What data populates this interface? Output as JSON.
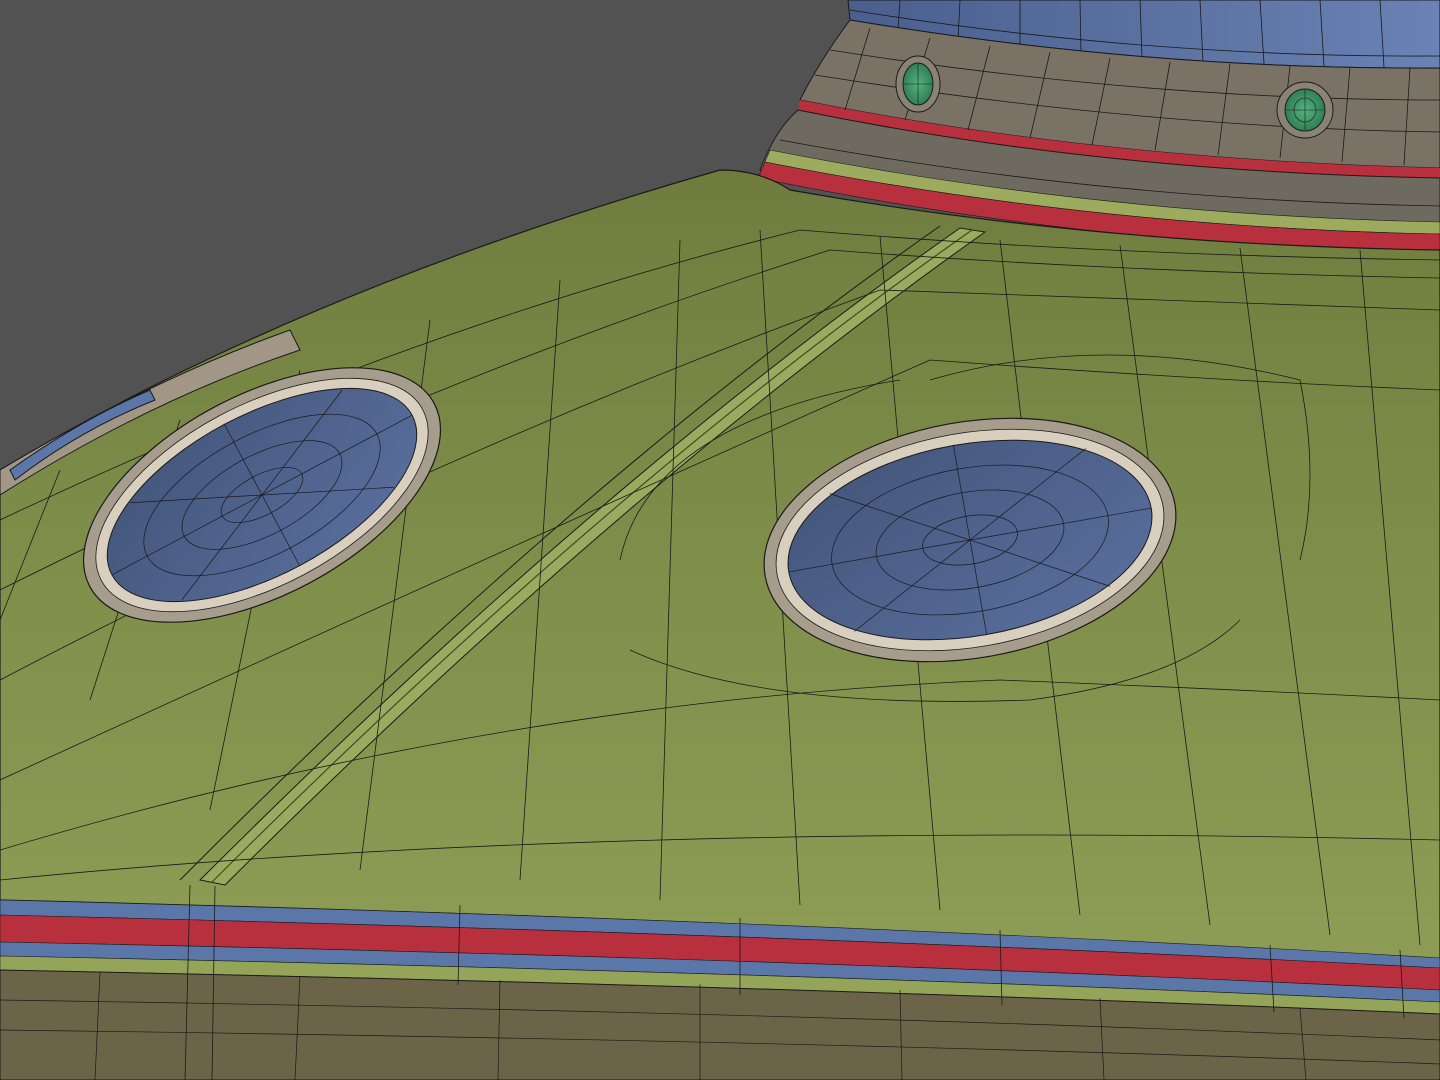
{
  "scene": {
    "subject": "wireframe-ufo-model",
    "colors": {
      "background": "#525252",
      "hull": "#7f8f4a",
      "hull_light": "#94a55a",
      "hull_dark": "#5f6d35",
      "window_glass": "#50648a",
      "window_rim": "#c9bfae",
      "stripe_red": "#b8303e",
      "stripe_blue": "#5b76a8",
      "collar": "#7b7266",
      "porthole_green": "#3f9a6a",
      "wire": "#1a1a1a"
    }
  }
}
